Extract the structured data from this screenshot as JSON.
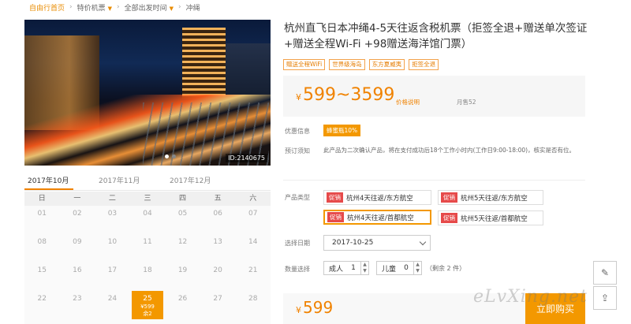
{
  "breadcrumb": {
    "home": "自由行首页",
    "special": "特价机票",
    "time": "全部出发时间",
    "sep": "›",
    "dest": "冲绳"
  },
  "photo": {
    "id_label": "ID:2140675"
  },
  "calendar": {
    "months": [
      "2017年10月",
      "2017年11月",
      "2017年12月"
    ],
    "weekdays": [
      "日",
      "一",
      "二",
      "三",
      "四",
      "五",
      "六"
    ],
    "rows": [
      [
        "01",
        "02",
        "03",
        "04",
        "05",
        "06",
        "07"
      ],
      [
        "08",
        "09",
        "10",
        "11",
        "12",
        "13",
        "14"
      ],
      [
        "15",
        "16",
        "17",
        "18",
        "19",
        "20",
        "21"
      ],
      [
        "22",
        "23",
        "24",
        "25",
        "26",
        "27",
        "28"
      ]
    ],
    "selected": {
      "day": "25",
      "price": "¥599",
      "remain": "余2"
    }
  },
  "product": {
    "title": "杭州直飞日本冲绳4-5天往返含税机票（拒签全退+赠送单次签证+赠送全程Wi-Fi +98赠送海洋馆门票）",
    "tags": [
      "赠送全程WiFi",
      "世界级海岛",
      "东方夏威夷",
      "拒签全退"
    ],
    "price_range": "599~3599",
    "yen": "¥",
    "price_note": "价格说明",
    "sold": "月售52",
    "promo_label": "优惠信息",
    "promo_value": "蜂蜜瓶10%",
    "booking_label": "预订须知",
    "booking_text": "此产品为二次确认产品，将在支付成功后18个工作小时内(工作日9:00-18:00)，核实是否有位。",
    "type_label": "产品类型",
    "badge": "促销",
    "options": [
      "杭州4天往返/东方航空",
      "杭州5天往返/东方航空",
      "杭州4天往返/首都航空",
      "杭州5天往返/首都航空"
    ],
    "date_label": "选择日期",
    "date_value": "2017-10-25",
    "qty_label": "数量选择",
    "adult_label": "成人",
    "adult_value": "1",
    "child_label": "儿童",
    "child_value": "0",
    "remain_text": "（剩余 2 件）",
    "bottom_price": "599",
    "buy_label": "立即购买"
  },
  "watermark": "eLvXing.net",
  "colors": {
    "accent": "#f39800",
    "badge": "#e64a4a"
  }
}
